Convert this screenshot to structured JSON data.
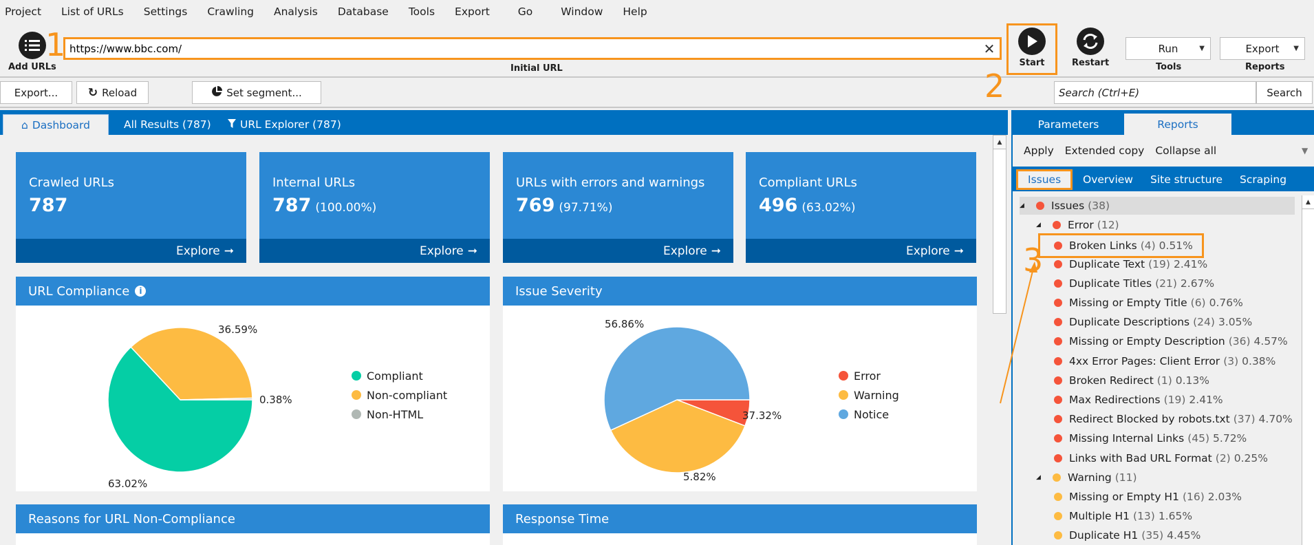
{
  "menu": [
    "Project",
    "List of URLs",
    "Settings",
    "Crawling",
    "Analysis",
    "Database",
    "Tools",
    "Export",
    "Go",
    "Window",
    "Help"
  ],
  "toolbar": {
    "add_urls_label": "Add URLs",
    "url_value": "https://www.bbc.com/",
    "url_caption": "Initial URL",
    "clear_glyph": "✕",
    "start_label": "Start",
    "restart_label": "Restart",
    "run_label": "Run",
    "tools_caption": "Tools",
    "export_label": "Export",
    "reports_caption": "Reports"
  },
  "callouts": {
    "one": "1",
    "two": "2",
    "three": "3",
    "accent": "#f7941d"
  },
  "secondary": {
    "export_label": "Export...",
    "reload_label": "Reload",
    "segment_label": "Set segment...",
    "search_placeholder": "Search (Ctrl+E)",
    "search_button": "Search"
  },
  "main_tabs": [
    {
      "label": "Dashboard",
      "icon": "home-icon",
      "active": true
    },
    {
      "label": "All Results (787)",
      "icon": "",
      "active": false
    },
    {
      "label": "URL Explorer (787)",
      "icon": "filter-icon",
      "active": false
    }
  ],
  "cards": [
    {
      "title": "Crawled URLs",
      "value": "787",
      "pct": "",
      "explore": "Explore"
    },
    {
      "title": "Internal URLs",
      "value": "787",
      "pct": "(100.00%)",
      "explore": "Explore"
    },
    {
      "title": "URLs with errors and warnings",
      "value": "769",
      "pct": "(97.71%)",
      "explore": "Explore"
    },
    {
      "title": "Compliant URLs",
      "value": "496",
      "pct": "(63.02%)",
      "explore": "Explore"
    }
  ],
  "panels": {
    "compliance_title": "URL Compliance",
    "severity_title": "Issue Severity",
    "reasons_title": "Reasons for URL Non-Compliance",
    "response_title": "Response Time"
  },
  "chart_data": [
    {
      "type": "pie",
      "title": "URL Compliance",
      "start": "3 o'clock, clockwise",
      "legend_position": "right",
      "slices": [
        {
          "label": "Compliant",
          "value": 63.02,
          "display": "63.02%",
          "color": "#05cea5"
        },
        {
          "label": "Non-compliant",
          "value": 36.59,
          "display": "36.59%",
          "color": "#fdbb42"
        },
        {
          "label": "Non-HTML",
          "value": 0.38,
          "display": "0.38%",
          "color": "#b0b8b4"
        }
      ]
    },
    {
      "type": "pie",
      "title": "Issue Severity",
      "start": "3 o'clock, clockwise",
      "legend_position": "right",
      "slices": [
        {
          "label": "Error",
          "value": 5.82,
          "display": "5.82%",
          "color": "#f5543a"
        },
        {
          "label": "Warning",
          "value": 37.32,
          "display": "37.32%",
          "color": "#fdbb42"
        },
        {
          "label": "Notice",
          "value": 56.86,
          "display": "56.86%",
          "color": "#5fa8e0"
        }
      ]
    }
  ],
  "right_panel": {
    "tabs": [
      {
        "label": "Parameters",
        "active": false
      },
      {
        "label": "Reports",
        "active": true
      }
    ],
    "actions": [
      "Apply",
      "Extended copy",
      "Collapse all"
    ],
    "subtabs": [
      {
        "label": "Issues",
        "active": true
      },
      {
        "label": "Overview",
        "active": false
      },
      {
        "label": "Site structure",
        "active": false
      },
      {
        "label": "Scraping",
        "active": false
      }
    ],
    "tree": [
      {
        "level": 0,
        "label": "Issues",
        "count": "(38)",
        "pct": "",
        "color": "#f5543a",
        "expanded": true
      },
      {
        "level": 1,
        "label": "Error",
        "count": "(12)",
        "pct": "",
        "color": "#f5543a",
        "expanded": true
      },
      {
        "level": 2,
        "label": "Broken Links",
        "count": "(4)",
        "pct": "0.51%",
        "color": "#f5543a",
        "highlighted": true
      },
      {
        "level": 2,
        "label": "Duplicate Text",
        "count": "(19)",
        "pct": "2.41%",
        "color": "#f5543a"
      },
      {
        "level": 2,
        "label": "Duplicate Titles",
        "count": "(21)",
        "pct": "2.67%",
        "color": "#f5543a"
      },
      {
        "level": 2,
        "label": "Missing or Empty Title",
        "count": "(6)",
        "pct": "0.76%",
        "color": "#f5543a"
      },
      {
        "level": 2,
        "label": "Duplicate Descriptions",
        "count": "(24)",
        "pct": "3.05%",
        "color": "#f5543a"
      },
      {
        "level": 2,
        "label": "Missing or Empty Description",
        "count": "(36)",
        "pct": "4.57%",
        "color": "#f5543a"
      },
      {
        "level": 2,
        "label": "4xx Error Pages: Client Error",
        "count": "(3)",
        "pct": "0.38%",
        "color": "#f5543a"
      },
      {
        "level": 2,
        "label": "Broken Redirect",
        "count": "(1)",
        "pct": "0.13%",
        "color": "#f5543a"
      },
      {
        "level": 2,
        "label": "Max Redirections",
        "count": "(19)",
        "pct": "2.41%",
        "color": "#f5543a"
      },
      {
        "level": 2,
        "label": "Redirect Blocked by robots.txt",
        "count": "(37)",
        "pct": "4.70%",
        "color": "#f5543a"
      },
      {
        "level": 2,
        "label": "Missing Internal Links",
        "count": "(45)",
        "pct": "5.72%",
        "color": "#f5543a"
      },
      {
        "level": 2,
        "label": "Links with Bad URL Format",
        "count": "(2)",
        "pct": "0.25%",
        "color": "#f5543a"
      },
      {
        "level": 1,
        "label": "Warning",
        "count": "(11)",
        "pct": "",
        "color": "#fdbb42",
        "expanded": true
      },
      {
        "level": 2,
        "label": "Missing or Empty H1",
        "count": "(16)",
        "pct": "2.03%",
        "color": "#fdbb42"
      },
      {
        "level": 2,
        "label": "Multiple H1",
        "count": "(13)",
        "pct": "1.65%",
        "color": "#fdbb42"
      },
      {
        "level": 2,
        "label": "Duplicate H1",
        "count": "(35)",
        "pct": "4.45%",
        "color": "#fdbb42"
      }
    ]
  }
}
